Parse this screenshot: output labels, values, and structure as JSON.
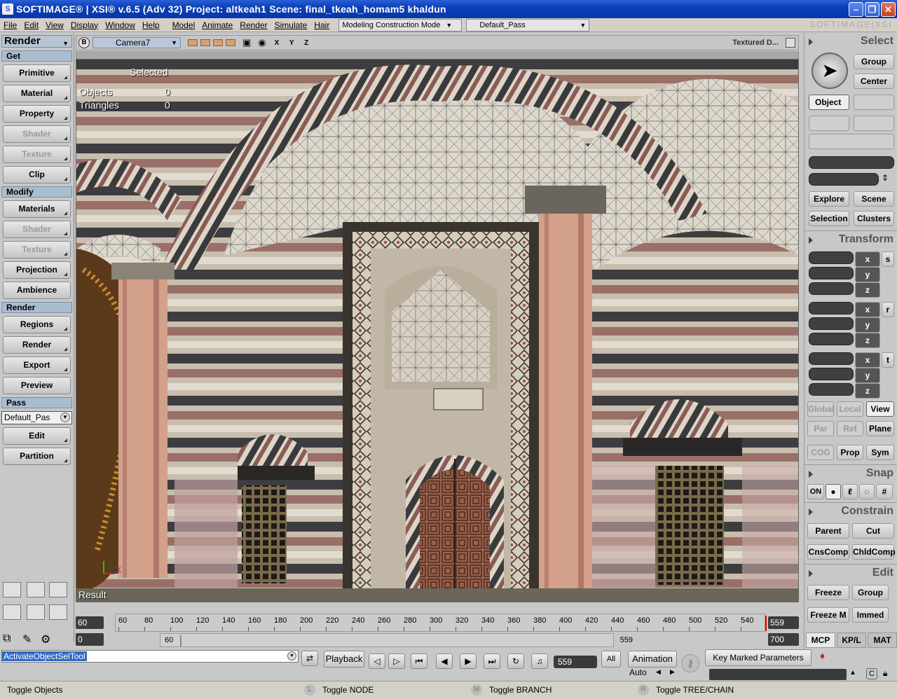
{
  "window": {
    "title": "SOFTIMAGE® | XSI® v.6.5 (Adv 32) Project: altkeah1     Scene: final_tkeah_homam5 khaldun",
    "brand": "SOFTIMAGE|XSI"
  },
  "menu": {
    "items": [
      "File",
      "Edit",
      "View",
      "Display",
      "Window",
      "Help",
      "Model",
      "Animate",
      "Render",
      "Simulate",
      "Hair"
    ],
    "construction_mode": "Modeling Construction Mode",
    "pass": "Default_Pass"
  },
  "left_panel": {
    "module": "Render",
    "sections": {
      "get": "Get",
      "modify": "Modify",
      "render": "Render",
      "pass": "Pass"
    },
    "get_buttons": [
      "Primitive",
      "Material",
      "Property",
      "Shader",
      "Texture",
      "Clip"
    ],
    "modify_buttons": [
      "Materials",
      "Shader",
      "Texture",
      "Projection",
      "Ambience"
    ],
    "render_buttons": [
      "Regions",
      "Render",
      "Export",
      "Preview"
    ],
    "pass_combo": "Default_Pas",
    "pass_buttons": [
      "Edit",
      "Partition"
    ]
  },
  "viewport": {
    "b_label": "B",
    "camera": "Camera7",
    "axes": "X Y Z",
    "shading": "Textured D...",
    "overlay": {
      "selected": "Selected",
      "objects_label": "Objects",
      "objects_value": "0",
      "triangles_label": "Triangles",
      "triangles_value": "0",
      "result": "Result",
      "axis_x": "X"
    }
  },
  "right_panel": {
    "select_title": "Select",
    "group": "Group",
    "center": "Center",
    "object": "Object",
    "explore": "Explore",
    "scene": "Scene",
    "selection": "Selection",
    "clusters": "Clusters",
    "transform_title": "Transform",
    "axes": [
      "x",
      "y",
      "z"
    ],
    "transform_tools": [
      "s",
      "r",
      "t"
    ],
    "global": "Global",
    "local": "Local",
    "view": "View",
    "par": "Par",
    "ref": "Ref",
    "plane": "Plane",
    "cog": "COG",
    "prop": "Prop",
    "sym": "Sym",
    "snap_title": "Snap",
    "snap_on": "ON",
    "constrain_title": "Constrain",
    "parent": "Parent",
    "cut": "Cut",
    "cnscomp": "CnsComp",
    "chldcomp": "ChldComp",
    "edit_title": "Edit",
    "freeze": "Freeze",
    "edit_group": "Group",
    "freeze_m": "Freeze M",
    "immed": "Immed",
    "tabs": [
      "MCP",
      "KP/L",
      "MAT"
    ]
  },
  "timeline": {
    "start": "60",
    "end": "559",
    "ticks": [
      "60",
      "80",
      "100",
      "120",
      "140",
      "160",
      "180",
      "200",
      "220",
      "240",
      "260",
      "280",
      "300",
      "320",
      "340",
      "360",
      "380",
      "400",
      "420",
      "440",
      "460",
      "480",
      "500",
      "520",
      "540"
    ],
    "range_start": "0",
    "range_in": "60",
    "range_out": "559",
    "range_end": "700",
    "current_frame": 559
  },
  "playback": {
    "command": "ActivateObjectSelTool",
    "playback_label": "Playback",
    "frame": "559",
    "all": "All",
    "animation": "Animation",
    "auto": "Auto",
    "key_marked": "Key Marked Parameters"
  },
  "status": {
    "toggle_objects": "Toggle Objects",
    "l_key": "L",
    "toggle_node": "Toggle NODE",
    "m_key": "M",
    "toggle_branch": "Toggle BRANCH",
    "r_key": "R",
    "toggle_tree": "Toggle TREE/CHAIN"
  },
  "colors": {
    "title_bar": "#0a3fb8",
    "section_header": "#a9bdd0",
    "selection_highlight": "#316ac5",
    "timeline_cursor": "#e00000"
  }
}
